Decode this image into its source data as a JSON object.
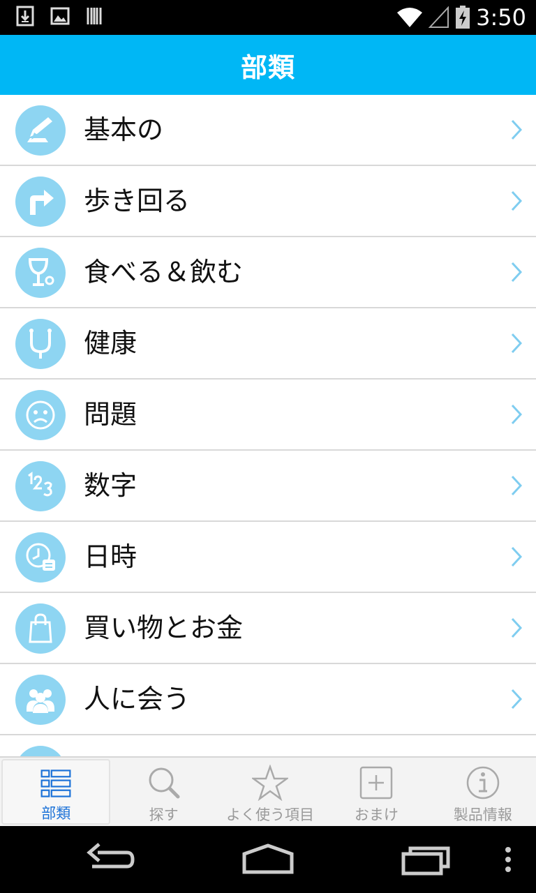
{
  "status_bar": {
    "time": "3:50"
  },
  "header": {
    "title": "部類"
  },
  "categories": [
    {
      "label": "基本の",
      "icon": "pencil-icon"
    },
    {
      "label": "歩き回る",
      "icon": "turn-right-arrow-icon"
    },
    {
      "label": "食べる＆飲む",
      "icon": "glass-icon"
    },
    {
      "label": "健康",
      "icon": "stethoscope-icon"
    },
    {
      "label": "問題",
      "icon": "sad-face-icon"
    },
    {
      "label": "数字",
      "icon": "numbers-icon"
    },
    {
      "label": "日時",
      "icon": "clock-calendar-icon"
    },
    {
      "label": "買い物とお金",
      "icon": "shopping-bag-icon"
    },
    {
      "label": "人に会う",
      "icon": "people-icon"
    }
  ],
  "tabs": [
    {
      "label": "部類",
      "icon": "list-icon",
      "active": true
    },
    {
      "label": "探す",
      "icon": "search-icon",
      "active": false
    },
    {
      "label": "よく使う項目",
      "icon": "star-icon",
      "active": false
    },
    {
      "label": "おまけ",
      "icon": "plus-box-icon",
      "active": false
    },
    {
      "label": "製品情報",
      "icon": "info-icon",
      "active": false
    }
  ],
  "colors": {
    "header": "#00b7f5",
    "icon_circle": "#8ed5f2",
    "active_tab": "#1e73d8",
    "chevron": "#7fcdf0"
  }
}
